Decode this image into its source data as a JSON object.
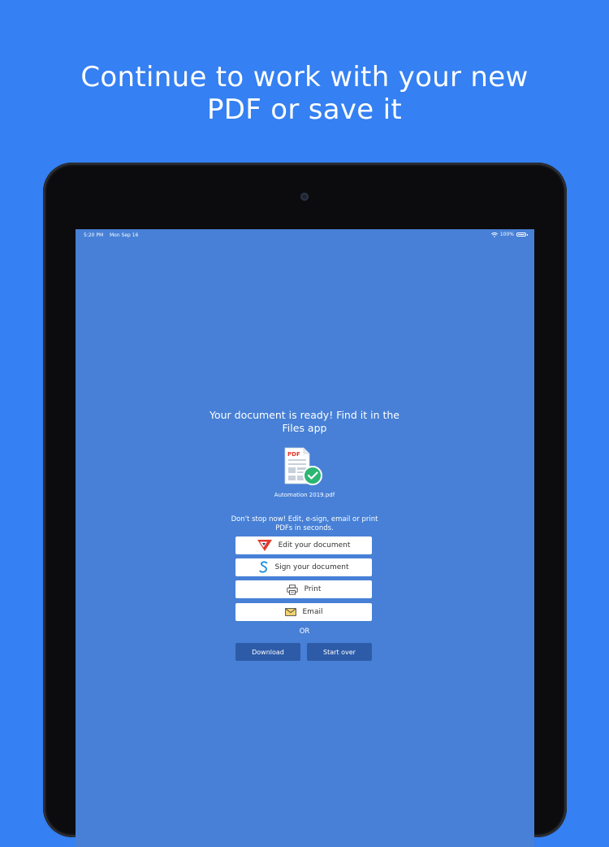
{
  "headline": {
    "line1": "Continue to work with your new",
    "line2": "PDF or save it"
  },
  "statusbar": {
    "time": "5:20 PM",
    "date": "Mon Sep 16",
    "battery": "100%"
  },
  "main": {
    "ready_message": "Your document is ready! Find it in the Files app",
    "file_icon_label": "PDF",
    "file_name": "Automation 2019.pdf",
    "promo_text": "Don't stop now! Edit, e-sign, email or print PDFs in seconds.",
    "actions": {
      "edit": "Edit your document",
      "sign": "Sign your document",
      "print": "Print",
      "email": "Email"
    },
    "or_label": "OR",
    "download_label": "Download",
    "start_over_label": "Start over"
  },
  "colors": {
    "background": "#3580f2",
    "screen": "#4780d6",
    "dark_button": "#2d5ba8",
    "pdf_red": "#e23a2e",
    "check_green": "#2bb673"
  }
}
